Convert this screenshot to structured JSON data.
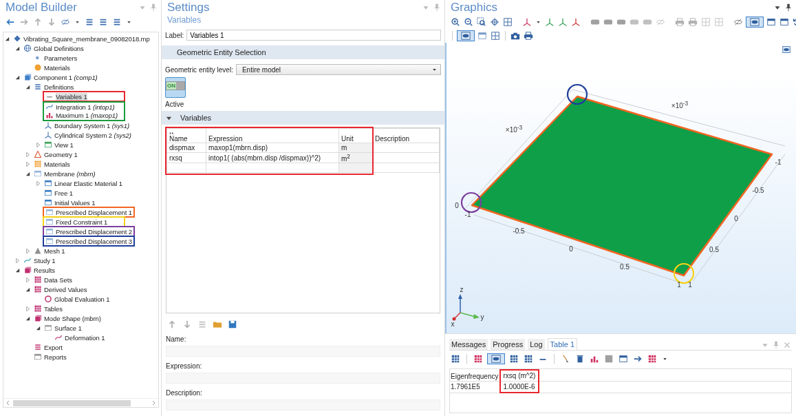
{
  "model_builder": {
    "title": "Model Builder",
    "tree": [
      {
        "label": "Vibrating_Square_membrane_09082018.mp",
        "kind": "model",
        "expanded": true,
        "selected": false,
        "children": [
          {
            "label": "Global Definitions",
            "kind": "globe",
            "expanded": true,
            "selected": false,
            "children": [
              {
                "label": "Parameters",
                "kind": "param",
                "selected": false
              },
              {
                "label": "Materials",
                "kind": "material",
                "selected": false
              }
            ]
          },
          {
            "label": "Component 1",
            "tag": "(comp1)",
            "kind": "component",
            "expanded": true,
            "selected": false,
            "children": [
              {
                "label": "Definitions",
                "kind": "definitions",
                "expanded": true,
                "selected": false,
                "children": [
                  {
                    "label": "Variables 1",
                    "kind": "variables",
                    "selected": true,
                    "color": "#e8262e"
                  },
                  {
                    "label": "Integration 1",
                    "tag": "(intop1)",
                    "kind": "integration",
                    "selected": false,
                    "color": "#1a9a3c"
                  },
                  {
                    "label": "Maximum 1",
                    "tag": "(maxop1)",
                    "kind": "maximum",
                    "selected": false,
                    "color": "#1a9a3c"
                  },
                  {
                    "label": "Boundary System 1",
                    "tag": "(sys1)",
                    "kind": "coord",
                    "selected": false
                  },
                  {
                    "label": "Cylindrical System 2",
                    "tag": "(sys2)",
                    "kind": "cylinder",
                    "selected": false
                  },
                  {
                    "label": "View 1",
                    "kind": "view",
                    "expanded": false,
                    "selected": false
                  }
                ]
              },
              {
                "label": "Geometry 1",
                "kind": "geometry",
                "expanded": false,
                "selected": false
              },
              {
                "label": "Materials",
                "kind": "materials2",
                "expanded": false,
                "selected": false
              },
              {
                "label": "Membrane",
                "tag": "(mbrn)",
                "kind": "physics",
                "expanded": true,
                "selected": false,
                "children": [
                  {
                    "label": "Linear Elastic Material 1",
                    "kind": "node",
                    "expanded": false,
                    "selected": false
                  },
                  {
                    "label": "Free 1",
                    "kind": "node",
                    "selected": false
                  },
                  {
                    "label": "Initial Values 1",
                    "kind": "node",
                    "selected": false
                  },
                  {
                    "label": "Prescribed Displacement 1",
                    "kind": "bc",
                    "selected": false,
                    "color": "#f26522"
                  },
                  {
                    "label": "Fixed Constraint 1",
                    "kind": "bc",
                    "selected": false,
                    "color": "#f7d117"
                  },
                  {
                    "label": "Prescribed Displacement 2",
                    "kind": "bc",
                    "selected": false,
                    "color": "#7b3f9e"
                  },
                  {
                    "label": "Prescribed Displacement 3",
                    "kind": "bc",
                    "selected": false,
                    "color": "#1f3e9b"
                  }
                ]
              },
              {
                "label": "Mesh 1",
                "kind": "mesh",
                "expanded": false,
                "selected": false
              }
            ]
          },
          {
            "label": "Study 1",
            "kind": "study",
            "expanded": false,
            "selected": false
          },
          {
            "label": "Results",
            "kind": "results",
            "expanded": true,
            "selected": false,
            "children": [
              {
                "label": "Data Sets",
                "kind": "dataset",
                "expanded": false,
                "selected": false
              },
              {
                "label": "Derived Values",
                "kind": "derived",
                "expanded": true,
                "selected": false,
                "children": [
                  {
                    "label": "Global Evaluation 1",
                    "kind": "eval",
                    "selected": false
                  }
                ]
              },
              {
                "label": "Tables",
                "kind": "table",
                "expanded": false,
                "selected": false
              },
              {
                "label": "Mode Shape (mbrn)",
                "kind": "plot",
                "expanded": true,
                "selected": false,
                "children": [
                  {
                    "label": "Surface 1",
                    "kind": "surface",
                    "expanded": true,
                    "selected": false,
                    "children": [
                      {
                        "label": "Deformation 1",
                        "kind": "deformation",
                        "selected": false
                      }
                    ]
                  }
                ]
              },
              {
                "label": "Export",
                "kind": "export",
                "selected": false
              },
              {
                "label": "Reports",
                "kind": "reports",
                "selected": false
              }
            ]
          }
        ]
      }
    ]
  },
  "settings": {
    "title": "Settings",
    "subtitle": "Variables",
    "label": {
      "caption": "Label:",
      "value": "Variables 1"
    },
    "selection_section": {
      "title": "Geometric Entity Selection"
    },
    "entity_level": {
      "caption": "Geometric entity level:",
      "value": "Entire model"
    },
    "active": {
      "badge": "ON",
      "label": "Active",
      "on": true
    },
    "variables_section": {
      "title": "Variables",
      "expanded": true
    },
    "variables_table": {
      "highlighted": true,
      "columns": [
        "Name",
        "Expression",
        "Unit",
        "Description"
      ],
      "rows": [
        {
          "name": "dispmax",
          "expression": "maxop1(mbrn.disp)",
          "unit": "m"
        },
        {
          "name": "rxsq",
          "expression": "intop1( (abs(mbrn.disp /dispmax))^2)",
          "unit": "m$^{2}$"
        }
      ]
    },
    "fields": [
      {
        "caption": "Name:"
      },
      {
        "caption": "Expression:"
      },
      {
        "caption": "Description:"
      }
    ]
  },
  "graphics": {
    "title": "Graphics",
    "axis_labels": [
      "×10$^{-3}$",
      "×10$^{-3}$",
      "0",
      "-1",
      "-0.5",
      "0",
      "0.5",
      "1",
      "1",
      "-1",
      "-0.5",
      "0",
      "0.5"
    ],
    "markers": [
      {
        "color": "#1f3e9b"
      },
      {
        "color": "#7b3f9e"
      },
      {
        "color": "#f7d117"
      }
    ],
    "triad_labels": [
      "z",
      "y",
      "x"
    ]
  },
  "results_panel": {
    "tabs": [
      {
        "label": "Messages",
        "selected": false
      },
      {
        "label": "Progress",
        "selected": false
      },
      {
        "label": "Log",
        "selected": false
      },
      {
        "label": "Table 1",
        "selected": true
      }
    ],
    "table": {
      "columns": [
        {
          "label": "Eigenfrequency",
          "highlighted": false
        },
        {
          "label": "rxsq (m^2)",
          "highlighted": true
        }
      ],
      "rows": [
        [
          "1.7961E5",
          "1.0000E-6"
        ]
      ]
    }
  }
}
